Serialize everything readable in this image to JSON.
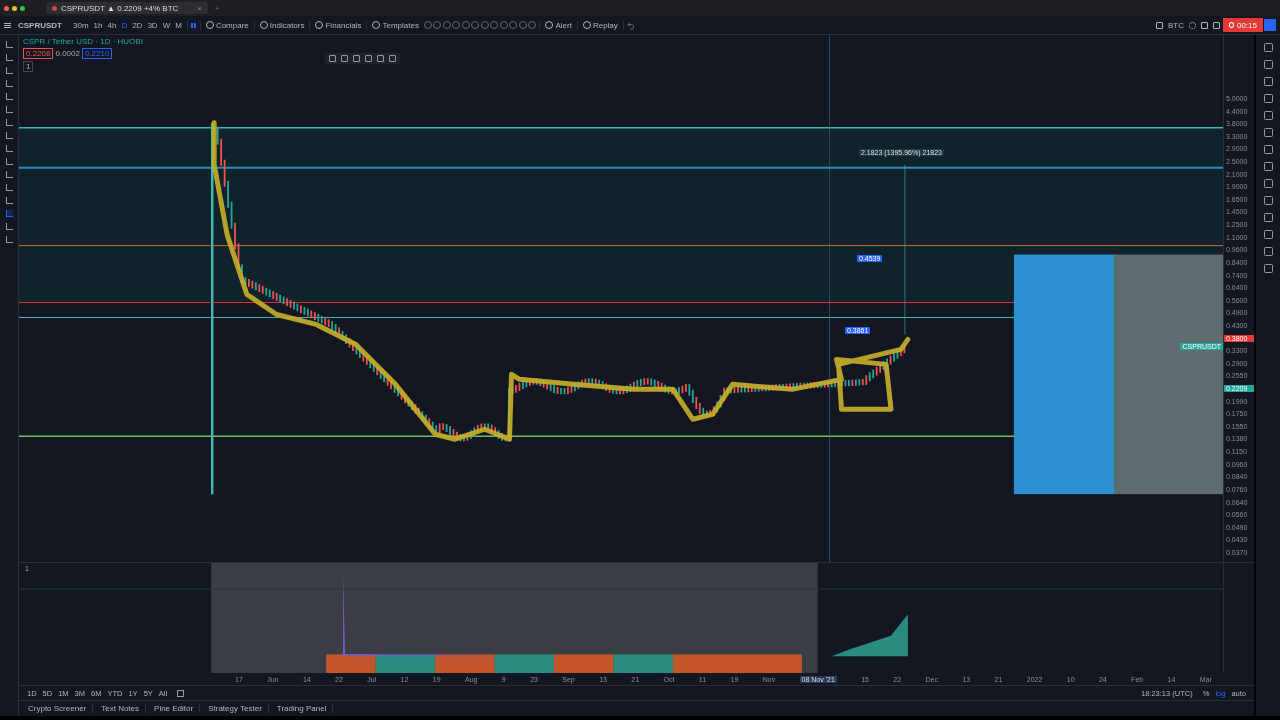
{
  "browser_tab": {
    "title": "CSPRUSDT ▲ 0.2209 +4% BTC",
    "close": "×",
    "new": "+"
  },
  "toolbar": {
    "symbol": "CSPRUSDT",
    "intervals": [
      {
        "label": "30m",
        "selected": false
      },
      {
        "label": "1h",
        "selected": false
      },
      {
        "label": "4h",
        "selected": false
      },
      {
        "label": "D",
        "selected": true
      },
      {
        "label": "2D",
        "selected": false
      },
      {
        "label": "3D",
        "selected": false
      },
      {
        "label": "W",
        "selected": false
      },
      {
        "label": "M",
        "selected": false
      }
    ],
    "buttons": [
      {
        "kind": "compare",
        "label": "Compare"
      },
      {
        "kind": "indicators",
        "label": "Indicators"
      },
      {
        "kind": "financials",
        "label": "Financials"
      },
      {
        "kind": "templates",
        "label": "Templates"
      },
      {
        "kind": "alert",
        "label": "Alert"
      },
      {
        "kind": "replay",
        "label": "Replay"
      }
    ]
  },
  "right_toolbar": {
    "currency": "BTC",
    "record_time": "00:15"
  },
  "legend": {
    "title": "CSPR / Tether USD · 1D · HUOBI",
    "sell": "0.2208",
    "spread": "0.0002",
    "buy": "0.2210",
    "collapse": "1"
  },
  "chart": {
    "measure_label": "2.1823 (1395.96%) 21823",
    "marker_labels": [
      "0.4539",
      "0.3861"
    ],
    "indicator_label": "1"
  },
  "price_axis": {
    "ticks": [
      {
        "label": "5.0000",
        "kind": "tick"
      },
      {
        "label": "4.4000",
        "kind": "tick"
      },
      {
        "label": "3.8000",
        "kind": "tick"
      },
      {
        "label": "3.3000",
        "kind": "tick"
      },
      {
        "label": "2.9000",
        "kind": "tick"
      },
      {
        "label": "2.5000",
        "kind": "tick"
      },
      {
        "label": "2.1000",
        "kind": "tick"
      },
      {
        "label": "1.9000",
        "kind": "tick"
      },
      {
        "label": "1.6500",
        "kind": "tick"
      },
      {
        "label": "1.4500",
        "kind": "tick"
      },
      {
        "label": "1.2500",
        "kind": "tick"
      },
      {
        "label": "1.1000",
        "kind": "tick"
      },
      {
        "label": "0.9600",
        "kind": "tick"
      },
      {
        "label": "0.8400",
        "kind": "tick"
      },
      {
        "label": "0.7400",
        "kind": "tick"
      },
      {
        "label": "0.6400",
        "kind": "tick"
      },
      {
        "label": "0.5600",
        "kind": "tick"
      },
      {
        "label": "0.4900",
        "kind": "tick"
      },
      {
        "label": "0.4300",
        "kind": "tick"
      },
      {
        "label": "0.3800",
        "kind": "alert"
      },
      {
        "label": "0.3300",
        "kind": "tick"
      },
      {
        "label": "0.2900",
        "kind": "tick"
      },
      {
        "label": "0.2550",
        "kind": "tick"
      },
      {
        "label": "0.2209",
        "kind": "last"
      },
      {
        "label": "0.1990",
        "kind": "tick"
      },
      {
        "label": "0.1750",
        "kind": "tick"
      },
      {
        "label": "0.1550",
        "kind": "tick"
      },
      {
        "label": "0.1380",
        "kind": "tick"
      },
      {
        "label": "0.1150",
        "kind": "tick"
      },
      {
        "label": "0.0960",
        "kind": "tick"
      },
      {
        "label": "0.0840",
        "kind": "tick"
      },
      {
        "label": "0.0760",
        "kind": "tick"
      },
      {
        "label": "0.0640",
        "kind": "tick"
      },
      {
        "label": "0.0560",
        "kind": "tick"
      },
      {
        "label": "0.0490",
        "kind": "tick"
      },
      {
        "label": "0.0430",
        "kind": "tick"
      },
      {
        "label": "0.0370",
        "kind": "tick"
      }
    ],
    "symbol_tag": "CSPRUSDT"
  },
  "time_axis": {
    "ticks_before": [
      "17",
      "Jun",
      "14",
      "22",
      "Jul",
      "12",
      "19",
      "Aug",
      "9",
      "23",
      "Sep",
      "13",
      "21",
      "Oct",
      "11",
      "19",
      "Nov"
    ],
    "cursor": "08 Nov '21",
    "ticks_after": [
      "15",
      "22",
      "Dec",
      "13",
      "21",
      "2022",
      "10",
      "24",
      "Feb",
      "14",
      "Mar"
    ]
  },
  "ranges": [
    "1D",
    "5D",
    "1M",
    "3M",
    "6M",
    "YTD",
    "1Y",
    "5Y",
    "All"
  ],
  "clock": "18:23:13 (UTC)",
  "scale": [
    {
      "label": "%",
      "selected": false
    },
    {
      "label": "log",
      "selected": true
    },
    {
      "label": "auto",
      "selected": false
    }
  ],
  "bottom_tabs": [
    "Crypto Screener",
    "Text Notes",
    "Pine Editor",
    "Strategy Tester",
    "Trading Panel"
  ]
}
